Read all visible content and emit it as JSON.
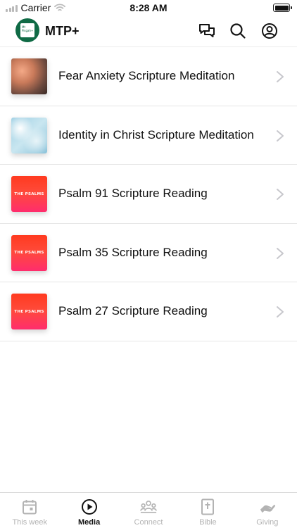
{
  "status_bar": {
    "carrier": "Carrier",
    "time": "8:28 AM"
  },
  "header": {
    "logo_text": "Mt Pisgah+",
    "title": "MTP+",
    "icons": [
      "chat-icon",
      "search-icon",
      "profile-icon"
    ]
  },
  "media": {
    "items": [
      {
        "title": "Fear Anxiety Scripture Meditation",
        "thumbnail": "clouds",
        "thumb_text": ""
      },
      {
        "title": "Identity in Christ Scripture Meditation",
        "thumbnail": "sky",
        "thumb_text": ""
      },
      {
        "title": "Psalm 91 Scripture Reading",
        "thumbnail": "psalms",
        "thumb_text": "THE PSALMS"
      },
      {
        "title": "Psalm 35 Scripture Reading",
        "thumbnail": "psalms",
        "thumb_text": "THE PSALMS"
      },
      {
        "title": "Psalm 27 Scripture Reading",
        "thumbnail": "psalms",
        "thumb_text": "THE PSALMS"
      }
    ]
  },
  "tabs": [
    {
      "label": "This week",
      "icon": "calendar-icon",
      "active": false
    },
    {
      "label": "Media",
      "icon": "play-icon",
      "active": true
    },
    {
      "label": "Connect",
      "icon": "group-icon",
      "active": false
    },
    {
      "label": "Bible",
      "icon": "bible-icon",
      "active": false
    },
    {
      "label": "Giving",
      "icon": "giving-icon",
      "active": false
    }
  ],
  "colors": {
    "brand_green": "#0f6a45",
    "tab_inactive": "#b3b3b3",
    "tab_active": "#111111"
  }
}
